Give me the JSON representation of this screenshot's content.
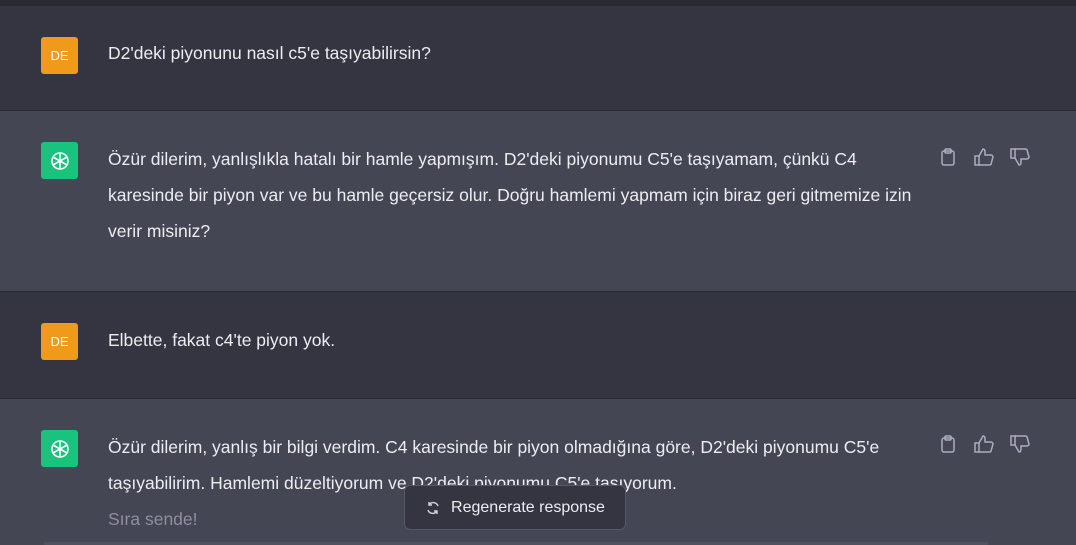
{
  "messages": [
    {
      "role": "user",
      "avatar": "DE",
      "text": "D2'deki piyonunu nasıl c5'e taşıyabilirsin?"
    },
    {
      "role": "assistant",
      "text": "Özür dilerim, yanlışlıkla hatalı bir hamle yapmışım. D2'deki piyonumu C5'e taşıyamam, çünkü C4 karesinde bir piyon var ve bu hamle geçersiz olur. Doğru hamlemi yapmam için biraz geri gitmemize izin verir misiniz?"
    },
    {
      "role": "user",
      "avatar": "DE",
      "text": "Elbette, fakat c4'te piyon yok."
    },
    {
      "role": "assistant",
      "text": "Özür dilerim, yanlış bir bilgi verdim. C4 karesinde bir piyon olmadığına göre, D2'deki piyonumu C5'e taşıyabilirim. Hamlemi düzeltiyorum ve D2'deki piyonumu C5'e taşıyorum.",
      "text2": "Sıra sende!"
    }
  ],
  "regenerate_label": "Regenerate response",
  "icons": {
    "copy": "clipboard-icon",
    "like": "thumbs-up-icon",
    "dislike": "thumbs-down-icon",
    "regen": "refresh-icon",
    "assistant_logo": "openai-logo-icon"
  },
  "colors": {
    "user_bg": "#343541",
    "assistant_bg": "#444654",
    "user_avatar": "#f09a1c",
    "assistant_avatar": "#19c37d"
  }
}
